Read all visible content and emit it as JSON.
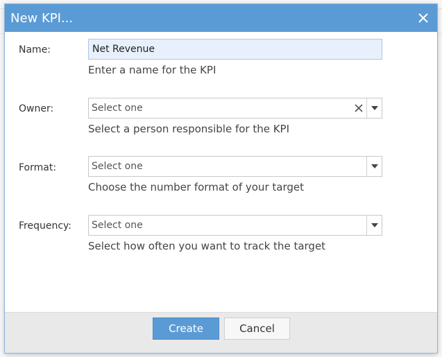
{
  "dialog": {
    "title": "New KPI...",
    "close_icon": "close-icon"
  },
  "fields": {
    "name": {
      "label": "Name:",
      "value": "Net Revenue",
      "hint": "Enter a name for the KPI"
    },
    "owner": {
      "label": "Owner:",
      "value": "Select one",
      "hint": "Select a person responsible for the KPI"
    },
    "format": {
      "label": "Format:",
      "value": "Select one",
      "hint": "Choose the number format of your target"
    },
    "frequency": {
      "label": "Frequency:",
      "value": "Select one",
      "hint": "Select how often you want to track the target"
    }
  },
  "footer": {
    "create_label": "Create",
    "cancel_label": "Cancel"
  },
  "colors": {
    "titlebar": "#5b9bd5",
    "primary_button": "#5b9bd5"
  }
}
